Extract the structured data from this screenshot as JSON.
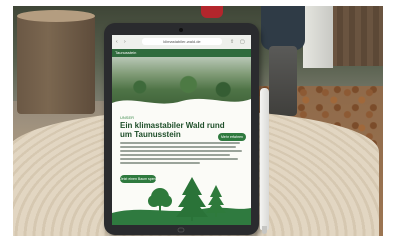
{
  "scene": {
    "description_colors": {
      "forest_green": "#2f7a3f",
      "headline_green": "#1f4f2a",
      "tablet_frame": "#2a2b2e"
    }
  },
  "tablet": {
    "browser": {
      "url": "klimastabiler-wald.de",
      "icons": [
        "back-icon",
        "share-icon",
        "tabs-icon"
      ]
    },
    "site": {
      "logo_text": "Taunusstein",
      "kicker": "UNSER",
      "headline": "Ein klimastabiler Wald rund um Taunusstein",
      "cta_right": "Mehr erfahren",
      "cta_main": "Jetzt einen Baum spenden"
    }
  }
}
